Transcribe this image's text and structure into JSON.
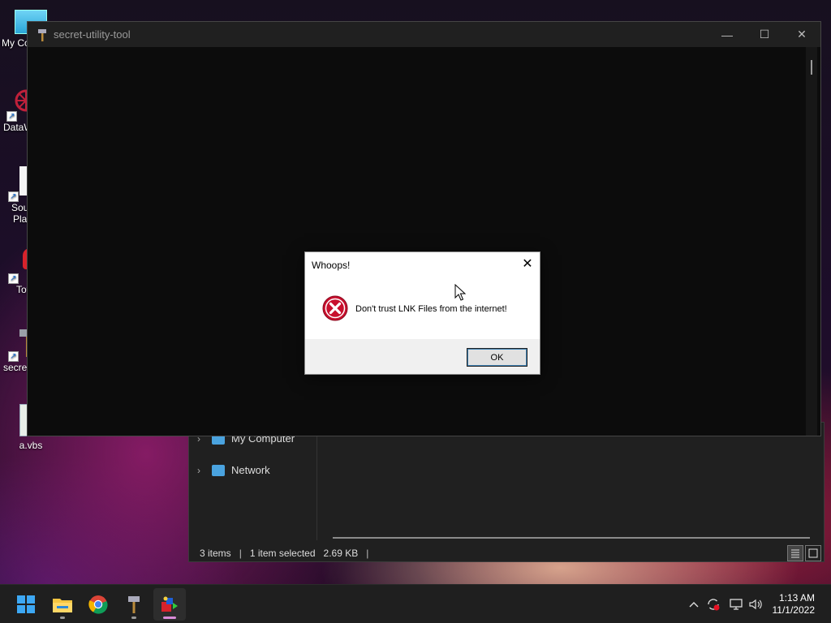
{
  "desktop": {
    "icons": [
      {
        "label": "My Co"
      },
      {
        "label": "DataW"
      },
      {
        "label": "Sou"
      },
      {
        "label": "Pla"
      },
      {
        "label": "Toy"
      },
      {
        "label": "secret"
      },
      {
        "label": "a.vbs"
      }
    ]
  },
  "app_window": {
    "title": "secret-utility-tool",
    "minimize_glyph": "—",
    "maximize_glyph": "☐",
    "close_glyph": "✕"
  },
  "dialog": {
    "title": "Whoops!",
    "message": "Don't trust LNK Files from the internet!",
    "ok_label": "OK",
    "close_glyph": "✕",
    "icon": "error-icon"
  },
  "explorer": {
    "nav_items": [
      {
        "label": "My Computer"
      },
      {
        "label": "Network"
      }
    ],
    "status": {
      "items": "3 items",
      "selected": "1 item selected",
      "size": "2.69 KB"
    }
  },
  "taskbar": {
    "apps": [
      "start-icon",
      "file-explorer-icon",
      "chrome-icon",
      "secret-utility-tool-icon",
      "active-app-icon"
    ],
    "clock_time": "1:13 AM",
    "clock_date": "11/1/2022"
  },
  "colors": {
    "accent": "#d98cd9",
    "error": "#c8102e"
  }
}
